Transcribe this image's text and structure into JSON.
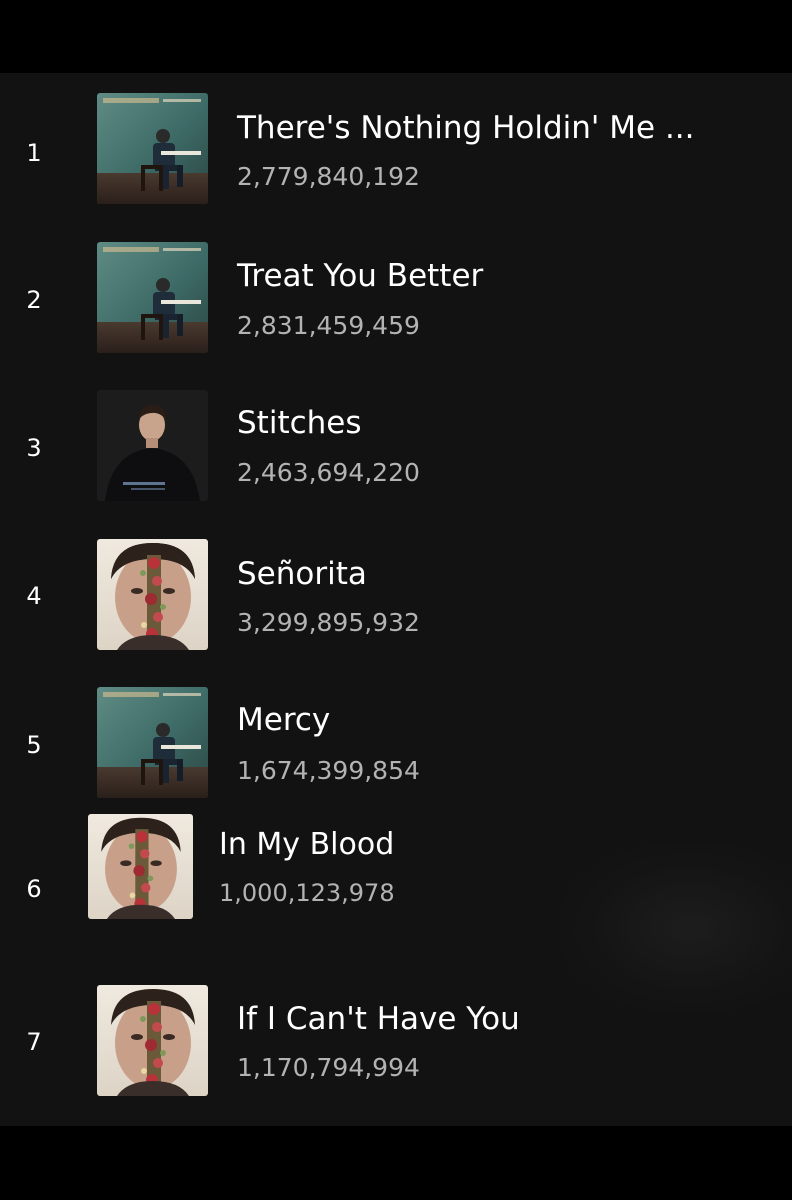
{
  "tracks": [
    {
      "rank": "1",
      "title": "There's Nothing Holdin' Me ...",
      "streams": "2,779,840,192",
      "art": "illuminate-cover-art"
    },
    {
      "rank": "2",
      "title": "Treat You Better",
      "streams": "2,831,459,459",
      "art": "illuminate-cover-art"
    },
    {
      "rank": "3",
      "title": "Stitches",
      "streams": "2,463,694,220",
      "art": "handwritten-cover-art"
    },
    {
      "rank": "4",
      "title": "Señorita",
      "streams": "3,299,895,932",
      "art": "shawn-mendes-flower-cover-art"
    },
    {
      "rank": "5",
      "title": "Mercy",
      "streams": "1,674,399,854",
      "art": "illuminate-cover-art"
    },
    {
      "rank": "6",
      "title": "In My Blood",
      "streams": "1,000,123,978",
      "art": "shawn-mendes-flower-cover-art"
    },
    {
      "rank": "7",
      "title": "If I Can't Have You",
      "streams": "1,170,794,994",
      "art": "shawn-mendes-flower-cover-art"
    }
  ],
  "colors": {
    "background": "#121212",
    "frame": "#000000",
    "title_text": "#ffffff",
    "streams_text": "#b3b3b3"
  }
}
